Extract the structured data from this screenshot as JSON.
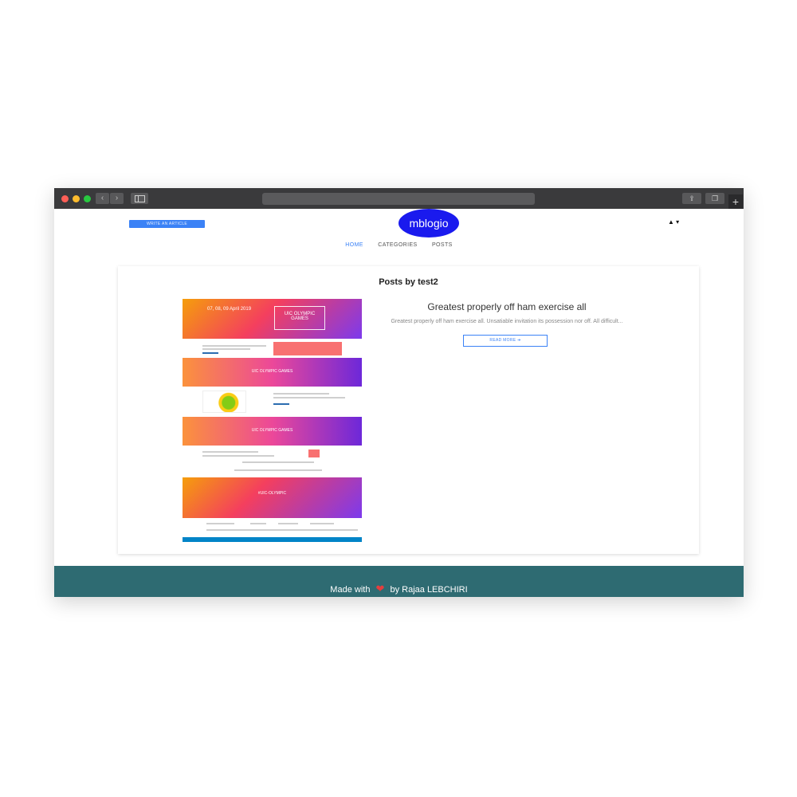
{
  "browser": {
    "back_glyph": "‹",
    "forward_glyph": "›",
    "share_glyph": "⇪",
    "tabs_glyph": "❐",
    "new_tab_glyph": "+"
  },
  "header": {
    "write_button": "WRITE AN ARTICLE",
    "logo": "mblogio",
    "user_menu_glyph": "▲ ▾"
  },
  "nav": {
    "items": [
      {
        "label": "HOME",
        "active": true
      },
      {
        "label": "CATEGORIES",
        "active": false
      },
      {
        "label": "POSTS",
        "active": false
      }
    ]
  },
  "main": {
    "title": "Posts by test2",
    "post": {
      "thumbnail": {
        "hero_date": "07, 08, 09 April 2019",
        "hero_brand": "UIC OLYMPIC GAMES",
        "strip_1": "UIC OLYMPIC GAMES",
        "strip_2": "UIC OLYMPIC GAMES",
        "strip_3": "#UIC-OLYMPIC"
      },
      "title": "Greatest properly off ham exercise all",
      "excerpt": "Greatest properly off ham exercise all. Unsatiable invitation its possession nor off. All difficult...",
      "read_more": "READ MORE ➔"
    }
  },
  "footer": {
    "made_with": "Made with",
    "heart": "❤",
    "by": "by Rajaa LEBCHIRI"
  },
  "colors": {
    "logo_bg": "#1a1aee",
    "accent": "#3b82f6",
    "footer_bg": "#2e6b72",
    "heart": "#e53e3e"
  }
}
